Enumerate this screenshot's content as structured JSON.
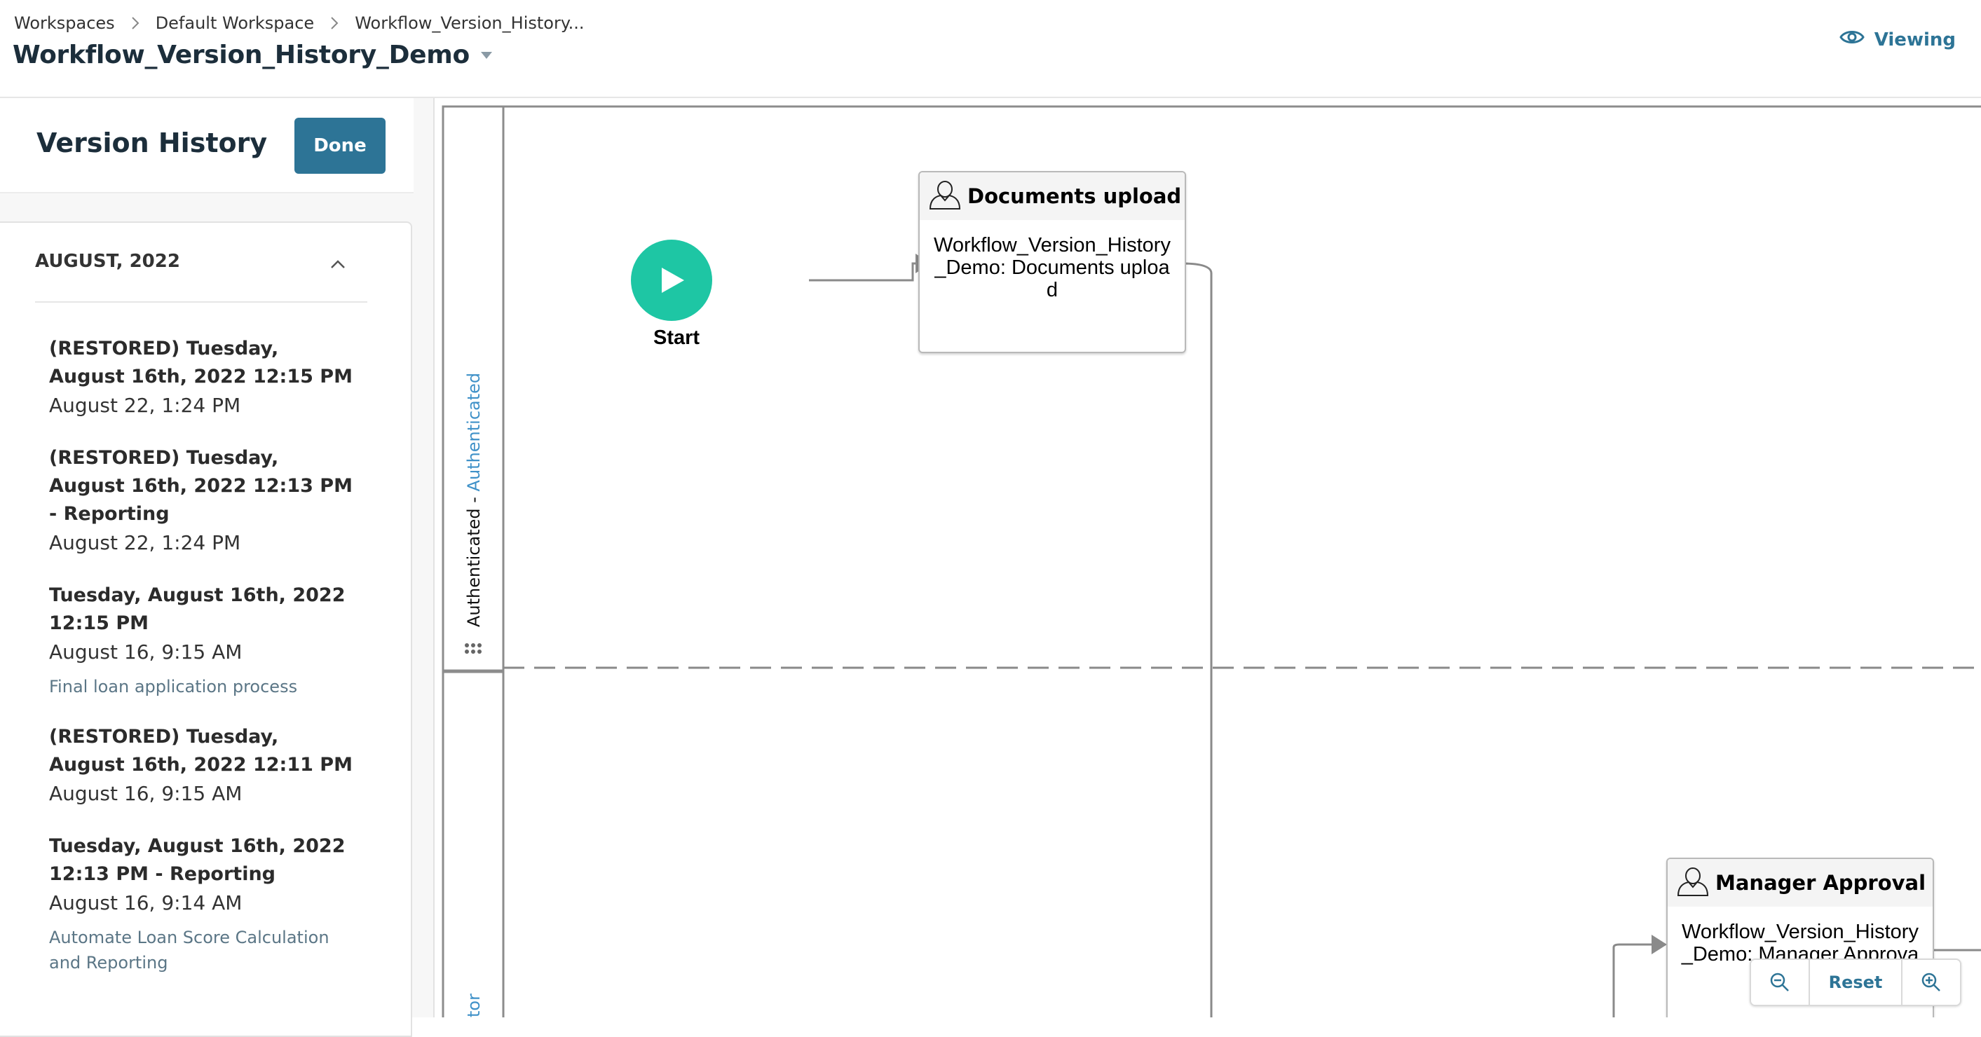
{
  "breadcrumb": {
    "items": [
      "Workspaces",
      "Default Workspace",
      "Workflow_Version_History..."
    ]
  },
  "header": {
    "title": "Workflow_Version_History_Demo",
    "viewing_label": "Viewing"
  },
  "sidebar": {
    "title": "Version History",
    "done_label": "Done",
    "month": "AUGUST, 2022",
    "versions": [
      {
        "name": "(RESTORED) Tuesday, August 16th, 2022 12:15 PM",
        "date": "August 22, 1:24 PM",
        "note": ""
      },
      {
        "name": "(RESTORED) Tuesday, August 16th, 2022 12:13 PM - Reporting",
        "date": "August 22, 1:24 PM",
        "note": ""
      },
      {
        "name": "Tuesday, August 16th, 2022 12:15 PM",
        "date": "August 16, 9:15 AM",
        "note": "Final loan application process"
      },
      {
        "name": "(RESTORED) Tuesday, August 16th, 2022 12:11 PM",
        "date": "August 16, 9:15 AM",
        "note": ""
      },
      {
        "name": "Tuesday, August 16th, 2022 12:13 PM - Reporting",
        "date": "August 16, 9:14 AM",
        "note": "Automate Loan Score Calculation and Reporting"
      }
    ]
  },
  "diagram": {
    "lane1_label_a": "Authenticated - ",
    "lane1_label_b": "Authenticated",
    "lane2_label_b": "tor",
    "start_label": "Start",
    "task1": {
      "title": "Documents upload",
      "body": "Workflow_Version_History_Demo: Documents upload"
    },
    "task2": {
      "title": "Manager Approval",
      "body": "Workflow_Version_History_Demo: Manager Approval"
    }
  },
  "zoom": {
    "reset_label": "Reset"
  },
  "colors": {
    "accent": "#2d7496",
    "start_node": "#1ec6a4",
    "lane_link": "#3f91c8"
  }
}
